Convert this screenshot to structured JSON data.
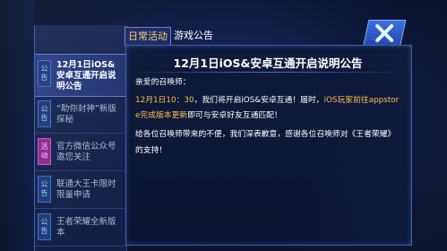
{
  "tabs": {
    "daily": "日常活动",
    "game": "游戏公告"
  },
  "left_list": [
    {
      "tag": "公告",
      "title": "12月1日iOS&安卓互通开启说明公告",
      "active": true,
      "tag_color": "blue"
    },
    {
      "tag": "公告",
      "title": "“助你封神”新版探秘",
      "active": false,
      "tag_color": "blue"
    },
    {
      "tag": "活动",
      "title": "官方微信公众号邀您关注",
      "active": false,
      "tag_color": "pink"
    },
    {
      "tag": "公告",
      "title": "联通大王卡限时限量申请",
      "active": false,
      "tag_color": "blue"
    },
    {
      "tag": "公告",
      "title": "王者荣耀全新版本",
      "active": false,
      "tag_color": "blue"
    }
  ],
  "notice": {
    "title": "12月1日iOS&安卓互通开启说明公告",
    "greeting": "亲爱的召唤师：",
    "line1_highlight": "12月1日10：30",
    "line1_rest": "，我们将开启iOS&安卓互通！届时，",
    "line1_highlight2": "iOS玩家前往appstor",
    "line2_highlight": "e完成版本更新",
    "line2_rest": "即可与安卓好友互通匹配！",
    "line3": "给各位召唤师带来的不便，我们深表歉意，感谢各位召唤师对《王者荣耀》",
    "line4": "的支持！"
  },
  "colors": {
    "highlight": "#f4c24c",
    "tab_active": "#ffd27a",
    "pink_tag": "#8a2b8d"
  },
  "icons": {
    "close": "close-x-icon"
  }
}
